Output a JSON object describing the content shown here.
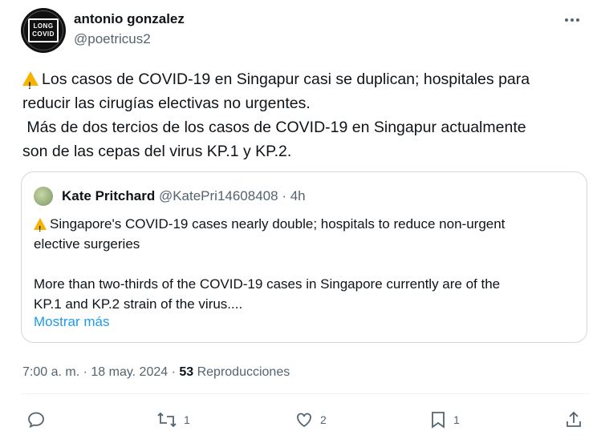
{
  "author": {
    "name": "antonio gonzalez",
    "handle": "@poetricus2",
    "avatar_text": [
      "LONG",
      "COVID"
    ]
  },
  "tweet": {
    "line1": "Los casos de COVID-19 en Singapur casi se duplican; hospitales para\nreducir las cirugías electivas no urgentes.",
    "line2": "\n Más de dos tercios de los casos de COVID-19 en Singapur actualmente\nson de las cepas del virus KP.1 y KP.2."
  },
  "quote": {
    "name": "Kate Pritchard",
    "handle": "@KatePri14608408",
    "time": "· 4h",
    "text1": "Singapore's COVID-19 cases nearly double; hospitals to reduce non-urgent\nelective surgeries",
    "text2": "\n\nMore than two-thirds of the COVID-19 cases in Singapore currently are of the\nKP.1 and KP.2 strain of the virus....",
    "show_more": "Mostrar más"
  },
  "meta": {
    "time": "7:00 a. m.",
    "sep1": " · ",
    "date": "18 may. 2024",
    "sep2": " · ",
    "views": "53",
    "views_label": " Reproducciones"
  },
  "actions": {
    "retweets": "1",
    "likes": "2",
    "bookmarks": "1"
  },
  "icons": [
    "warning-icon",
    "more-icon",
    "reply-icon",
    "retweet-icon",
    "like-icon",
    "bookmark-icon",
    "share-icon"
  ]
}
